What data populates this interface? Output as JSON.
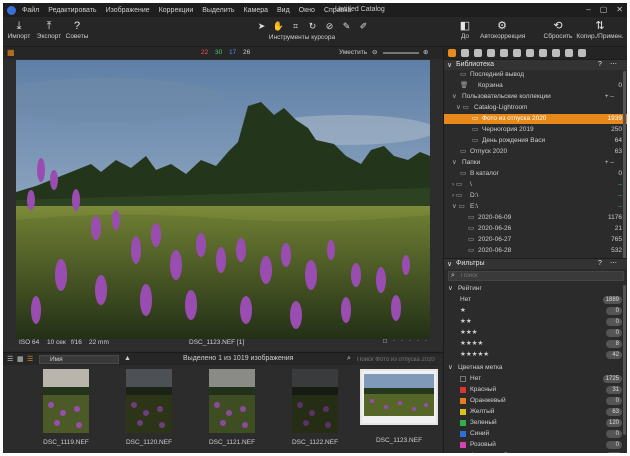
{
  "menubar": {
    "items": [
      "Файл",
      "Редактировать",
      "Изображение",
      "Коррекции",
      "Выделить",
      "Камера",
      "Вид",
      "Окно",
      "Справка"
    ],
    "doc_title": "Untitled Catalog",
    "win_controls": [
      "–",
      "▢",
      "✕"
    ]
  },
  "toolbar": {
    "import": "Импорт",
    "export": "Экспорт",
    "tips": "Советы",
    "cursor_tools": "Инструменты курсора",
    "before": "До",
    "autocorr": "Автокоррекция",
    "reset": "Сбросить",
    "copy_apply": "Копир./Примен."
  },
  "viewer": {
    "color_counts": [
      "22",
      "30",
      "17",
      "26"
    ],
    "count_colors": [
      "#ff4d4d",
      "#39d36a",
      "#4a8cff",
      "#cfcfcf"
    ],
    "fit_label": "Уместить",
    "iso": "ISO 64",
    "shutter": "10 сек",
    "aperture": "f/16",
    "focal": "22 mm",
    "filename": "DSC_1123.NEF [1]"
  },
  "browser": {
    "sort": "Имя",
    "status": "Выделено 1 из 1019 изображения",
    "search_placeholder": "Поиск Фото из отпуска 2020",
    "thumbs": [
      "DSC_1119.NEF",
      "DSC_1120.NEF",
      "DSC_1121.NEF",
      "DSC_1122.NEF",
      "DSC_1123.NEF"
    ]
  },
  "library": {
    "title": "Библиотека",
    "items": [
      {
        "label": "Последний вывод",
        "count": "",
        "indent": 16,
        "icon": "▭"
      },
      {
        "label": "Корзина",
        "count": "0",
        "indent": 16,
        "icon": "🗑"
      },
      {
        "label": "Пользовательские коллекции",
        "count": "",
        "indent": 8,
        "icon": "∨",
        "section": true
      },
      {
        "label": "Catalog-Lightroom",
        "count": "",
        "indent": 12,
        "icon": "∨ ▭"
      },
      {
        "label": "Фото из отпуска 2020",
        "count": "1939",
        "indent": 28,
        "icon": "▭",
        "hl": true
      },
      {
        "label": "Черногория 2019",
        "count": "250",
        "indent": 28,
        "icon": "▭"
      },
      {
        "label": "День рождения Васи",
        "count": "64",
        "indent": 28,
        "icon": "▭"
      },
      {
        "label": "Отпуск 2020",
        "count": "63",
        "indent": 16,
        "icon": "▭"
      },
      {
        "label": "Папки",
        "count": "",
        "indent": 8,
        "icon": "∨",
        "section": true
      },
      {
        "label": "В каталог",
        "count": "0",
        "indent": 16,
        "icon": "▭"
      },
      {
        "label": "\\",
        "count": "–",
        "indent": 8,
        "icon": "› ▭",
        "green": true
      },
      {
        "label": "D:\\",
        "count": "–",
        "indent": 8,
        "icon": "› ▭",
        "green": true
      },
      {
        "label": "E:\\",
        "count": "–",
        "indent": 8,
        "icon": "∨ ▭",
        "green": true
      },
      {
        "label": "2020-06-09",
        "count": "1176",
        "indent": 24,
        "icon": "▭"
      },
      {
        "label": "2020-06-26",
        "count": "21",
        "indent": 24,
        "icon": "▭"
      },
      {
        "label": "2020-06-27",
        "count": "765",
        "indent": 24,
        "icon": "▭"
      },
      {
        "label": "2020-06-28",
        "count": "532",
        "indent": 24,
        "icon": "▭"
      }
    ]
  },
  "filters": {
    "title": "Фильтры",
    "search_placeholder": "Поиск",
    "rating_title": "Рейтинг",
    "ratings": [
      {
        "label": "Нет",
        "count": "1889"
      },
      {
        "label": "★",
        "count": "0"
      },
      {
        "label": "★★",
        "count": "0"
      },
      {
        "label": "★★★",
        "count": "0"
      },
      {
        "label": "★★★★",
        "count": "8"
      },
      {
        "label": "★★★★★",
        "count": "42"
      }
    ],
    "color_title": "Цветная метка",
    "colors": [
      {
        "label": "Нет",
        "count": "1725",
        "color": "#2b2b2b"
      },
      {
        "label": "Красный",
        "count": "31",
        "color": "#d33"
      },
      {
        "label": "Оранжевый",
        "count": "0",
        "color": "#e87d1e"
      },
      {
        "label": "Желтый",
        "count": "63",
        "color": "#d8c21e"
      },
      {
        "label": "Зеленый",
        "count": "120",
        "color": "#2db24a"
      },
      {
        "label": "Синий",
        "count": "0",
        "color": "#2e6fd6"
      },
      {
        "label": "Розовый",
        "count": "0",
        "color": "#d641b5"
      },
      {
        "label": "Фиолетовый",
        "count": "0",
        "color": "#8a3fd1"
      }
    ]
  }
}
